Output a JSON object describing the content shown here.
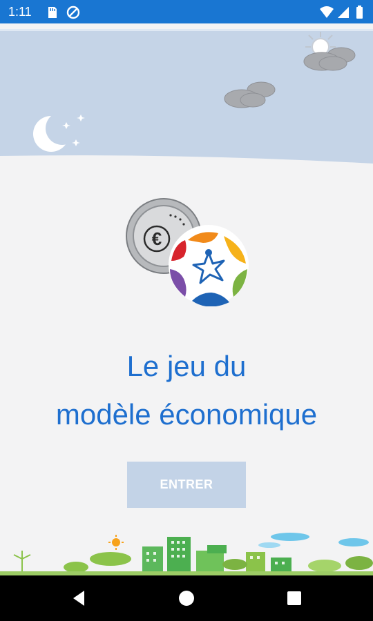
{
  "status_bar": {
    "time": "1:11",
    "icons": [
      "sd-card-icon",
      "data-saver-icon",
      "wifi-icon",
      "signal-icon",
      "battery-icon"
    ]
  },
  "main": {
    "title_line1": "Le jeu du",
    "title_line2": "modèle économique",
    "enter_button_label": "ENTRER"
  },
  "navigation_bar": {
    "buttons": [
      "back-icon",
      "home-icon",
      "recents-icon"
    ]
  },
  "colors": {
    "status_bar": "#1976d2",
    "sky": "#c5d4e7",
    "title": "#1e6fcf",
    "button": "#c3d3e7",
    "background": "#f3f3f4"
  }
}
